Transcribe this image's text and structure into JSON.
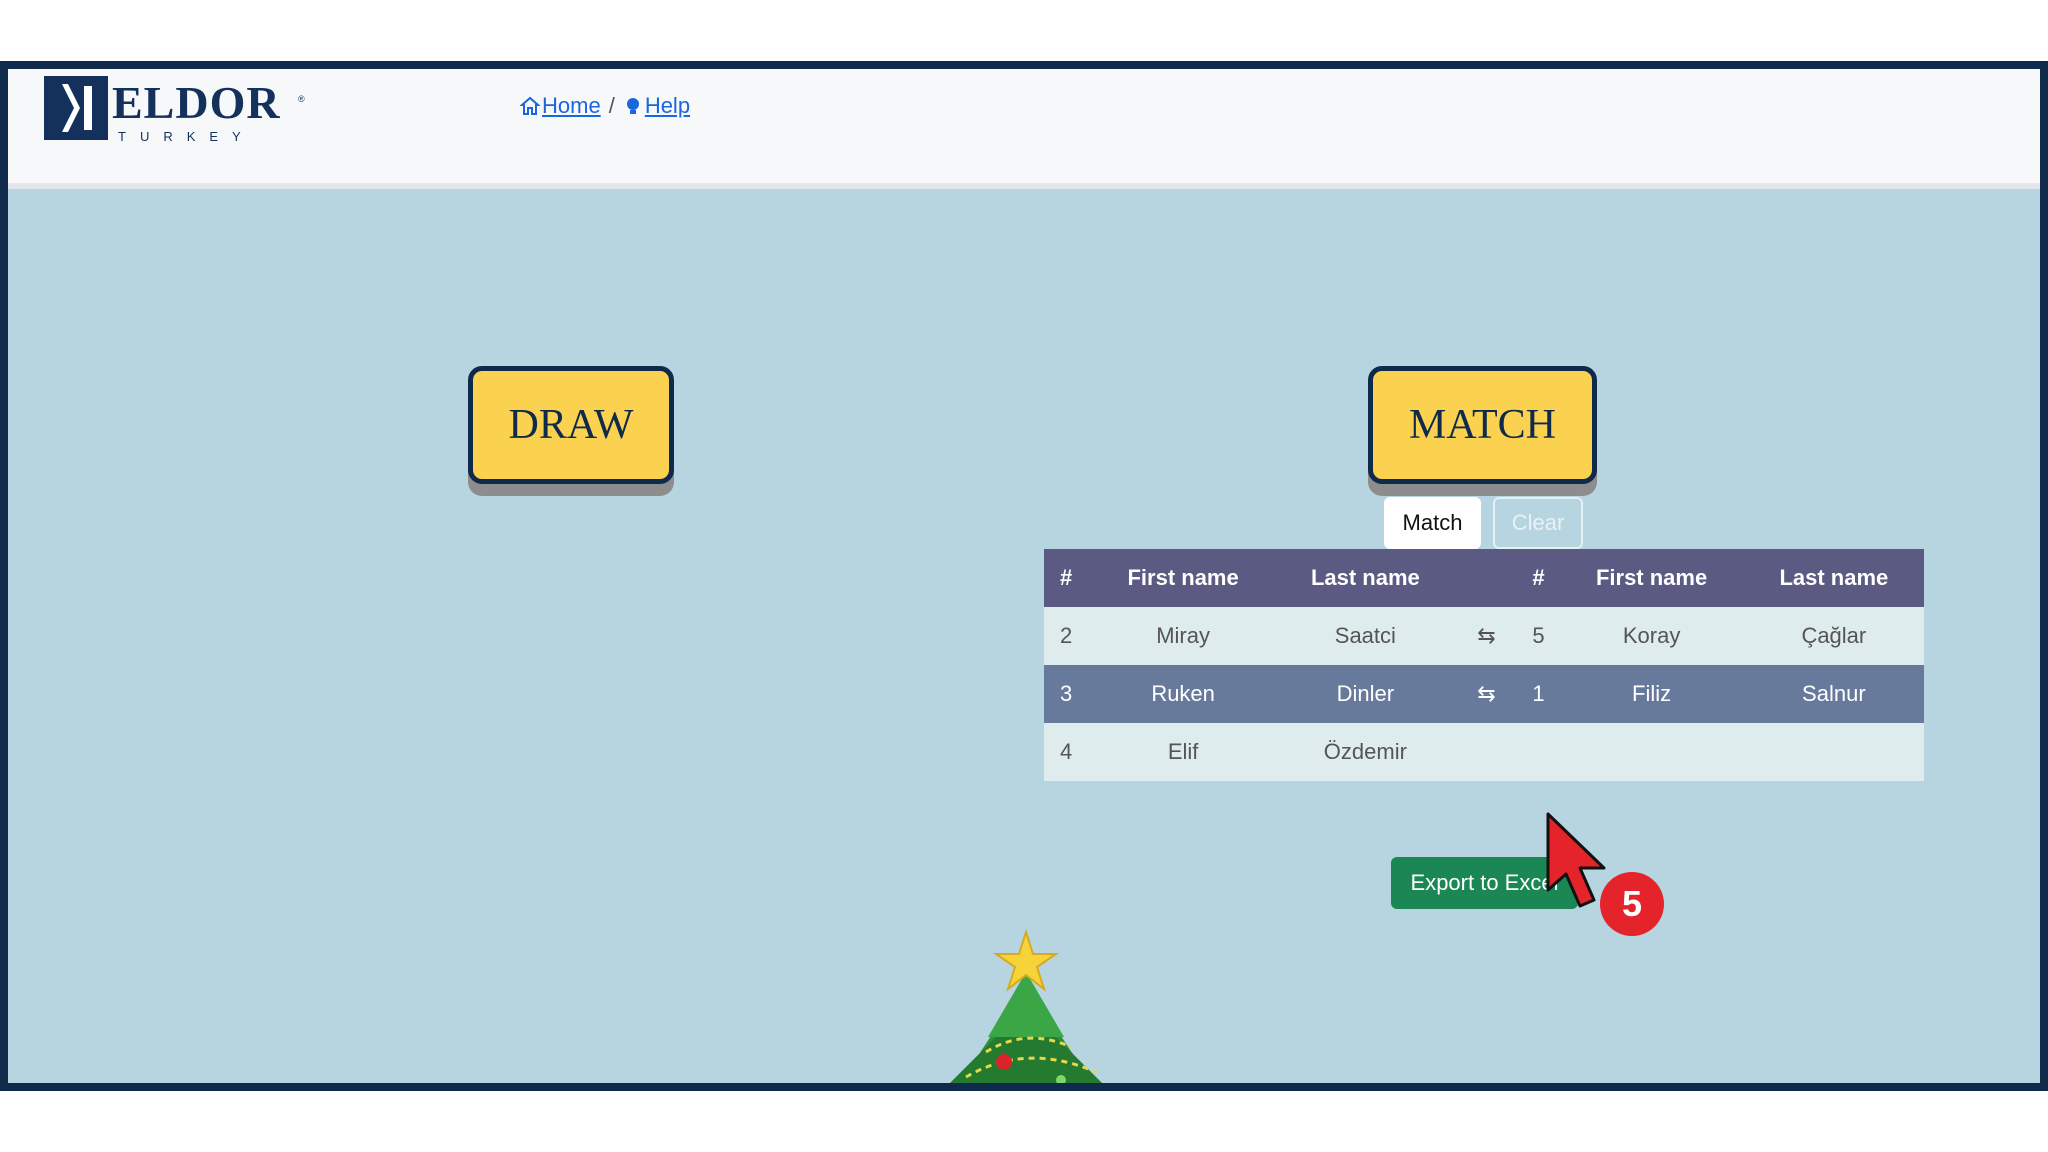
{
  "brand": {
    "name": "ELDOR",
    "sub": "TURKEY",
    "reg": "®"
  },
  "breadcrumb": {
    "home": "Home",
    "separator": "/",
    "help": "Help"
  },
  "buttons": {
    "draw": "DRAW",
    "match_big": "MATCH",
    "match": "Match",
    "clear": "Clear",
    "export": "Export to Excel"
  },
  "table": {
    "headers": [
      "#",
      "First name",
      "Last name",
      "",
      "#",
      "First name",
      "Last name"
    ],
    "swap_symbol": "⇆",
    "rows": [
      {
        "num": "2",
        "first": "Miray",
        "last": "Saatci",
        "num2": "5",
        "first2": "Koray",
        "last2": "Çağlar",
        "style": "light"
      },
      {
        "num": "3",
        "first": "Ruken",
        "last": "Dinler",
        "num2": "1",
        "first2": "Filiz",
        "last2": "Salnur",
        "style": "dark"
      },
      {
        "num": "4",
        "first": "Elif",
        "last": "Özdemir",
        "num2": "",
        "first2": "",
        "last2": "",
        "style": "light"
      }
    ]
  },
  "step_badge": "5",
  "icons": {
    "home": "home-icon",
    "help": "lightbulb-icon",
    "cursor": "arrow-cursor-icon",
    "tree": "christmas-tree-icon"
  },
  "colors": {
    "frame": "#0f2a4a",
    "background": "#b7d5e0",
    "big_button": "#fbd150",
    "table_header": "#5a5a82",
    "export": "#1a8754",
    "badge": "#e4232b"
  }
}
